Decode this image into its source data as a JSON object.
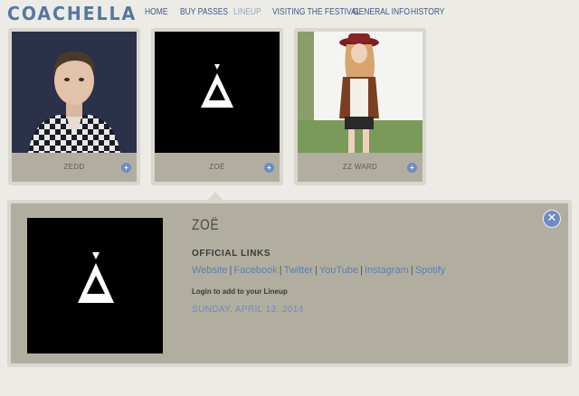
{
  "header": {
    "logo": "COACHELLA",
    "nav": [
      {
        "label": "HOME",
        "active": false
      },
      {
        "label": "BUY PASSES",
        "active": false
      },
      {
        "label": "LINEUP",
        "active": true
      },
      {
        "label": "VISITING THE FESTIVAL",
        "active": false
      },
      {
        "label": "GENERAL INFO",
        "active": false
      },
      {
        "label": "HISTORY",
        "active": false
      }
    ]
  },
  "cards": [
    {
      "name": "ZEDD",
      "photo": "portrait-man-plaid-shirt"
    },
    {
      "name": "ZOË",
      "photo": "zoe-triangle-logo"
    },
    {
      "name": "ZZ WARD",
      "photo": "portrait-woman-red-hat"
    }
  ],
  "detail": {
    "title": "ZOË",
    "links_heading": "OFFICIAL LINKS",
    "links": [
      "Website",
      "Facebook",
      "Twitter",
      "YouTube",
      "Instagram",
      "Spotify"
    ],
    "login_note": "Login to add to your Lineup",
    "date": "SUNDAY, APRIL 13, 2014"
  },
  "icons": {
    "card_more": "plus-icon",
    "close": "close-icon"
  },
  "colors": {
    "accent": "#6d8cc2",
    "nav": "#3f5a86",
    "panel": "#b2ae9f",
    "background": "#ecebe6"
  }
}
